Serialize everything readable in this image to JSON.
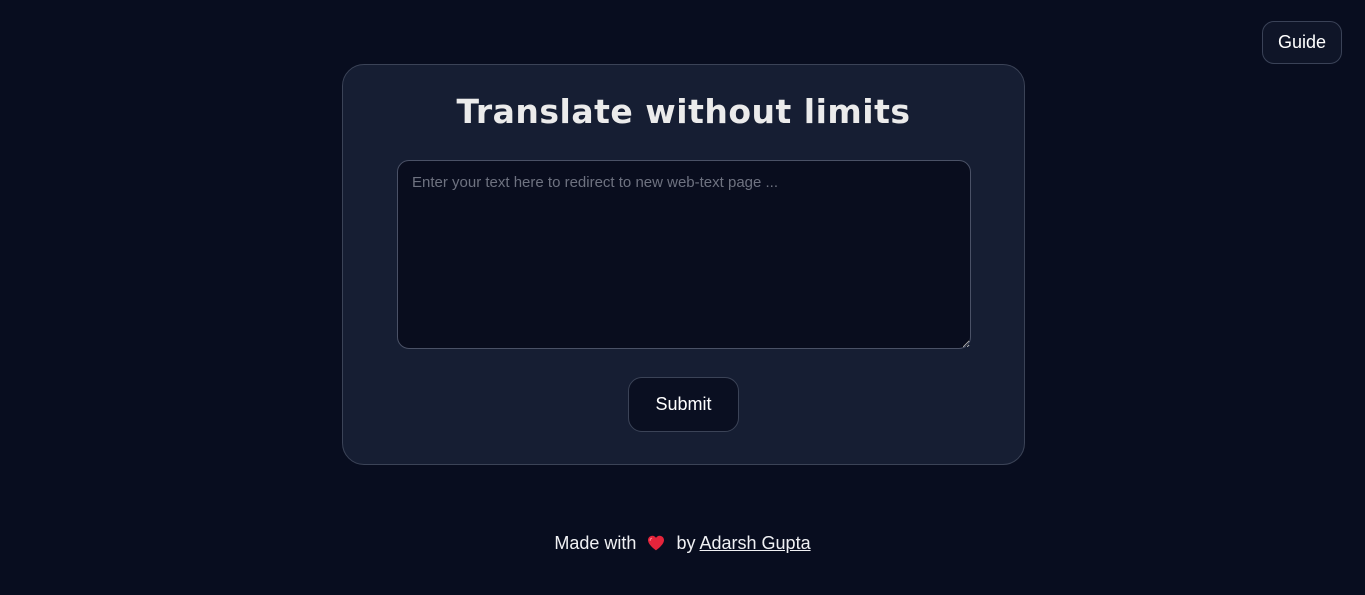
{
  "header": {
    "guide_label": "Guide"
  },
  "card": {
    "title": "Translate without limits",
    "textarea": {
      "value": "",
      "placeholder": "Enter your text here to redirect to new web-text page ..."
    },
    "submit_label": "Submit"
  },
  "footer": {
    "made_with": "Made with",
    "heart_icon": "heart-icon",
    "by": "by",
    "author": "Adarsh Gupta"
  },
  "colors": {
    "background": "#080d1f",
    "card_background": "#161e33",
    "heart": "#e5243b"
  }
}
